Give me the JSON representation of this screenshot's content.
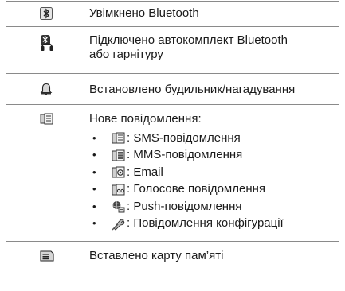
{
  "rows": [
    {
      "icon": "bluetooth-icon",
      "lines": [
        "Увімкнено Bluetooth"
      ]
    },
    {
      "icon": "bluetooth-headset-icon",
      "lines": [
        "Підключено автокомплект Bluetooth",
        "або гарнітуру"
      ]
    },
    {
      "icon": "alarm-bell-icon",
      "lines": [
        "Встановлено будильник/нагадування"
      ]
    },
    {
      "icon": "new-message-icon",
      "lines": [
        "Нове повідомлення:"
      ],
      "sub_items": [
        {
          "icon": "sms-message-icon",
          "text": ": SMS-повідомлення"
        },
        {
          "icon": "mms-message-icon",
          "text": ": MMS-повідомлення"
        },
        {
          "icon": "email-icon",
          "text": ": Email"
        },
        {
          "icon": "voice-message-icon",
          "text": ": Голосове повідомлення"
        },
        {
          "icon": "push-message-icon",
          "text": ": Push-повідомлення"
        },
        {
          "icon": "configuration-message-icon",
          "text": ": Повідомлення конфігурації"
        }
      ]
    },
    {
      "icon": "memory-card-icon",
      "lines": [
        "Вставлено карту пам’яті"
      ]
    }
  ],
  "bullet": "•"
}
